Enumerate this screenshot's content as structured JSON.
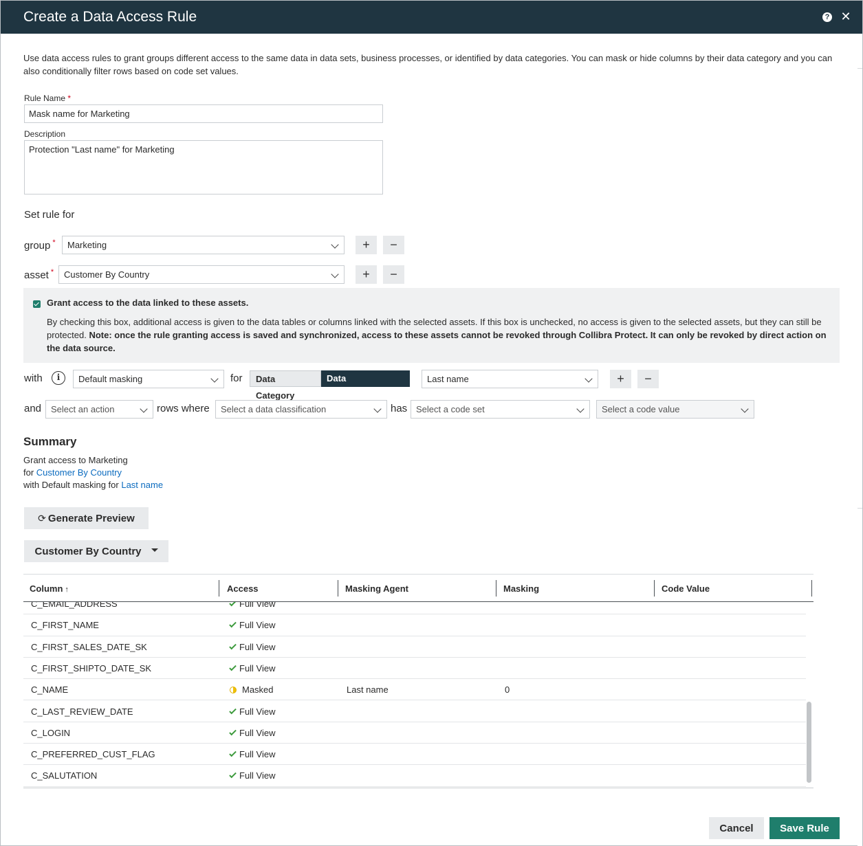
{
  "dialog": {
    "title": "Create a Data Access Rule",
    "intro": "Use data access rules to grant groups different access to the same data in data sets, business processes, or identified by data categories. You can mask or hide columns by their data category and you can also conditionally filter rows based on code set values."
  },
  "form": {
    "rule_name_label": "Rule Name",
    "required_mark": "*",
    "rule_name_value": "Mask name for Marketing",
    "description_label": "Description",
    "description_value": "Protection \"Last name\" for Marketing",
    "set_rule_for": "Set rule for",
    "group_label": "group",
    "group_value": "Marketing",
    "asset_label": "asset",
    "asset_value": "Customer By Country",
    "plus_glyph": "+",
    "minus_glyph": "−"
  },
  "grant": {
    "checked": true,
    "title": "Grant access to the data linked to these assets.",
    "desc_normal": "By checking this box, additional access is given to the data tables or columns linked with the selected assets. If this box is unchecked, no access is given to the selected assets, but they can still be protected. ",
    "desc_bold": "Note: once the rule granting access is saved and synchronized, access to these assets cannot be revoked through Collibra Protect. It can only be revoked by direct action on the data source."
  },
  "with_row": {
    "with_label": "with",
    "info_glyph": "i",
    "masking_value": "Default masking",
    "for_label": "for",
    "toggle_category": "Data Category",
    "toggle_classification": "Data Classification",
    "classification_value": "Last name"
  },
  "and_row": {
    "and_label": "and",
    "action_placeholder": "Select an action",
    "rows_where_label": "rows where",
    "classification_placeholder": "Select a data classification",
    "has_label": "has",
    "code_set_placeholder": "Select a code set",
    "code_value_placeholder": "Select a code value"
  },
  "summary": {
    "title": "Summary",
    "line1": "Grant access to Marketing",
    "line2_prefix": "for ",
    "line2_link": "Customer By Country",
    "line3_prefix": "with Default masking for ",
    "line3_link": "Last name"
  },
  "preview": {
    "refresh_glyph": "⟳",
    "generate_label": "Generate Preview",
    "asset_dropdown": "Customer By Country"
  },
  "table": {
    "columns": [
      "Column",
      "Access",
      "Masking Agent",
      "Masking",
      "Code Value"
    ],
    "sort_glyph": "↑",
    "rows": [
      {
        "column": "C_EMAIL_ADDRESS",
        "access": "Full View",
        "status": "full",
        "agent": "",
        "masking": "",
        "code": ""
      },
      {
        "column": "C_FIRST_NAME",
        "access": "Full View",
        "status": "full",
        "agent": "",
        "masking": "",
        "code": ""
      },
      {
        "column": "C_FIRST_SALES_DATE_SK",
        "access": "Full View",
        "status": "full",
        "agent": "",
        "masking": "",
        "code": ""
      },
      {
        "column": "C_FIRST_SHIPTO_DATE_SK",
        "access": "Full View",
        "status": "full",
        "agent": "",
        "masking": "",
        "code": ""
      },
      {
        "column": "C_NAME",
        "access": "Masked",
        "status": "masked",
        "agent": "Last name",
        "masking": "0",
        "code": ""
      },
      {
        "column": "C_LAST_REVIEW_DATE",
        "access": "Full View",
        "status": "full",
        "agent": "",
        "masking": "",
        "code": ""
      },
      {
        "column": "C_LOGIN",
        "access": "Full View",
        "status": "full",
        "agent": "",
        "masking": "",
        "code": ""
      },
      {
        "column": "C_PREFERRED_CUST_FLAG",
        "access": "Full View",
        "status": "full",
        "agent": "",
        "masking": "",
        "code": ""
      },
      {
        "column": "C_SALUTATION",
        "access": "Full View",
        "status": "full",
        "agent": "",
        "masking": "",
        "code": ""
      }
    ]
  },
  "footer": {
    "cancel_label": "Cancel",
    "save_label": "Save Rule"
  },
  "colors": {
    "header_bg": "#1f3541",
    "accent_green": "#1f7e6c",
    "link_blue": "#0b6bbf",
    "check_green": "#3c9a3c",
    "masked_yellow": "#f0c000"
  }
}
